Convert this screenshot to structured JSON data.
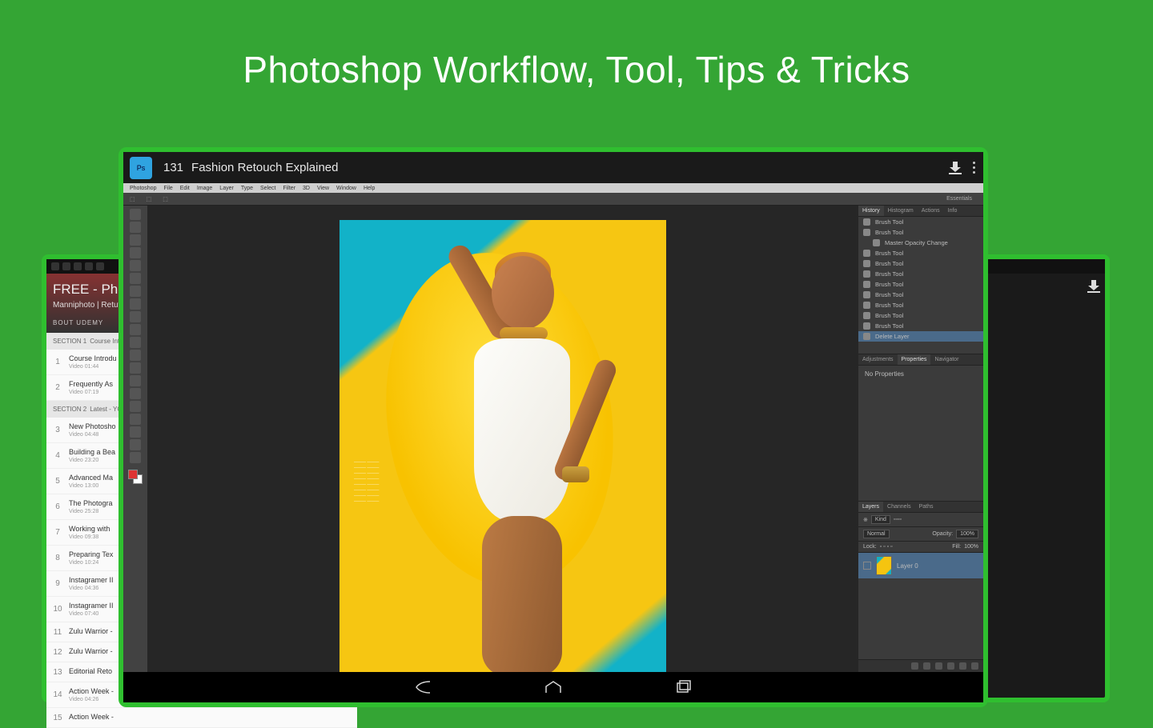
{
  "headline": "Photoshop Workflow, Tool, Tips & Tricks",
  "appbar": {
    "icon_label": "Ps",
    "lesson_no": "131",
    "title": "Fashion Retouch Explained"
  },
  "options_bar": {
    "essentials": "Essentials"
  },
  "ps_menu": [
    "Photoshop",
    "File",
    "Edit",
    "Image",
    "Layer",
    "Type",
    "Select",
    "Filter",
    "3D",
    "View",
    "Window",
    "Help"
  ],
  "panels": {
    "history_tabs": [
      "History",
      "Histogram",
      "Actions",
      "Info"
    ],
    "history": [
      {
        "label": "Brush Tool"
      },
      {
        "label": "Brush Tool"
      },
      {
        "label": "Master Opacity Change",
        "indent": true
      },
      {
        "label": "Brush Tool"
      },
      {
        "label": "Brush Tool"
      },
      {
        "label": "Brush Tool"
      },
      {
        "label": "Brush Tool"
      },
      {
        "label": "Brush Tool"
      },
      {
        "label": "Brush Tool"
      },
      {
        "label": "Brush Tool"
      },
      {
        "label": "Brush Tool"
      },
      {
        "label": "Delete Layer",
        "selected": true
      }
    ],
    "props_tabs": [
      "Adjustments",
      "Properties",
      "Navigator"
    ],
    "props_body": "No Properties",
    "layers_tabs": [
      "Layers",
      "Channels",
      "Paths"
    ],
    "layers_opts": {
      "kind": "Kind",
      "mode": "Normal",
      "opacity_label": "Opacity:",
      "opacity": "100%",
      "lock": "Lock:",
      "fill_label": "Fill:",
      "fill": "100%"
    },
    "layer_name": "Layer 0"
  },
  "course_left": {
    "title": "FREE - Photo",
    "sub": "Manniphoto  | Retutpr",
    "about": "BOUT UDEMY",
    "sections": [
      {
        "header": "SECTION 1",
        "sub": "Course Introdu",
        "items": [
          {
            "n": "1",
            "t": "Course Introdu",
            "d": "Video 01:44"
          },
          {
            "n": "2",
            "t": "Frequently As",
            "d": "Video 07:19"
          }
        ]
      },
      {
        "header": "SECTION 2",
        "sub": "Latest - YOUT",
        "items": [
          {
            "n": "3",
            "t": "New Photosho",
            "d": "Video 04:48"
          },
          {
            "n": "4",
            "t": "Building a Bea",
            "d": "Video 23:20"
          },
          {
            "n": "5",
            "t": "Advanced Ma",
            "d": "Video 13:00"
          },
          {
            "n": "6",
            "t": "The Photogra",
            "d": "Video 25:28"
          },
          {
            "n": "7",
            "t": "Working with",
            "d": "Video 09:38"
          },
          {
            "n": "8",
            "t": "Preparing Tex",
            "d": "Video 10:24"
          },
          {
            "n": "9",
            "t": "Instagramer II",
            "d": "Video 04:36"
          },
          {
            "n": "10",
            "t": "Instagramer II",
            "d": "Video 07:40"
          },
          {
            "n": "11",
            "t": "Zulu Warrior -",
            "d": ""
          },
          {
            "n": "12",
            "t": "Zulu Warrior -",
            "d": ""
          },
          {
            "n": "13",
            "t": "Editorial Reto",
            "d": ""
          },
          {
            "n": "14",
            "t": "Action Week -",
            "d": "Video 04:26"
          },
          {
            "n": "15",
            "t": "Action Week -",
            "d": ""
          }
        ]
      }
    ]
  }
}
